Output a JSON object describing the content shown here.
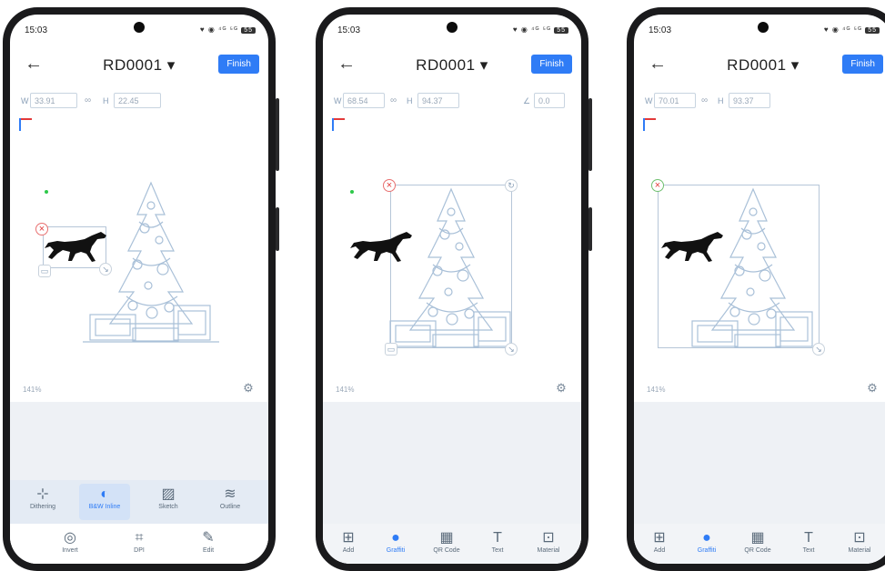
{
  "phones": [
    {
      "status": {
        "time": "15:03",
        "icons": "♥ ◉ ⁴ᴳ ⁵ᴳ",
        "battery": "55"
      },
      "nav": {
        "title": "RD0001 ▾",
        "finish": "Finish",
        "back": "←"
      },
      "dims": {
        "w_label": "W",
        "w_value": "33.91",
        "h_label": "H",
        "h_value": "22.45",
        "link": "∞"
      },
      "zoom": "141%",
      "tools_top": [
        {
          "icon": "dithering-icon",
          "glyph": "⊹",
          "label": "Dithering"
        },
        {
          "icon": "bw-icon",
          "glyph": "◐",
          "label": "B&W Inline"
        },
        {
          "icon": "sketch-icon",
          "glyph": "▨",
          "label": "Sketch"
        },
        {
          "icon": "outline-icon",
          "glyph": "≋",
          "label": "Outline"
        }
      ],
      "tools_bottom": [
        {
          "icon": "invert-icon",
          "glyph": "◎",
          "label": "Invert"
        },
        {
          "icon": "dpi-icon",
          "glyph": "⌗",
          "label": "DPI"
        },
        {
          "icon": "edit-icon",
          "glyph": "✎",
          "label": "Edit"
        }
      ]
    },
    {
      "status": {
        "time": "15:03",
        "icons": "♥ ◉ ⁴ᴳ ⁵ᴳ",
        "battery": "55"
      },
      "nav": {
        "title": "RD0001 ▾",
        "finish": "Finish",
        "back": "←"
      },
      "dims": {
        "w_label": "W",
        "w_value": "68.54",
        "h_label": "H",
        "h_value": "94.37",
        "link": "∞",
        "angle_label": "∠",
        "angle_value": "0.0"
      },
      "zoom": "141%",
      "tools_bottom": [
        {
          "icon": "add-icon",
          "glyph": "⊞",
          "label": "Add"
        },
        {
          "icon": "graffiti-icon",
          "glyph": "●",
          "label": "Graffiti"
        },
        {
          "icon": "qr-code-icon",
          "glyph": "▦",
          "label": "QR Code"
        },
        {
          "icon": "text-icon",
          "glyph": "T",
          "label": "Text"
        },
        {
          "icon": "material-icon",
          "glyph": "⊡",
          "label": "Material"
        }
      ]
    },
    {
      "status": {
        "time": "15:03",
        "icons": "♥ ◉ ⁴ᴳ ⁵ᴳ",
        "battery": "55"
      },
      "nav": {
        "title": "RD0001 ▾",
        "finish": "Finish",
        "back": "←"
      },
      "dims": {
        "w_label": "W",
        "w_value": "70.01",
        "h_label": "H",
        "h_value": "93.37",
        "link": "∞"
      },
      "zoom": "141%",
      "tools_bottom": [
        {
          "icon": "add-icon",
          "glyph": "⊞",
          "label": "Add"
        },
        {
          "icon": "graffiti-icon",
          "glyph": "●",
          "label": "Graffiti"
        },
        {
          "icon": "qr-code-icon",
          "glyph": "▦",
          "label": "QR Code"
        },
        {
          "icon": "text-icon",
          "glyph": "T",
          "label": "Text"
        },
        {
          "icon": "material-icon",
          "glyph": "⊡",
          "label": "Material"
        }
      ]
    }
  ],
  "colors": {
    "accent": "#2f7cf6",
    "delete": "#e23a3a",
    "tree_stroke": "#9fb8d2"
  }
}
